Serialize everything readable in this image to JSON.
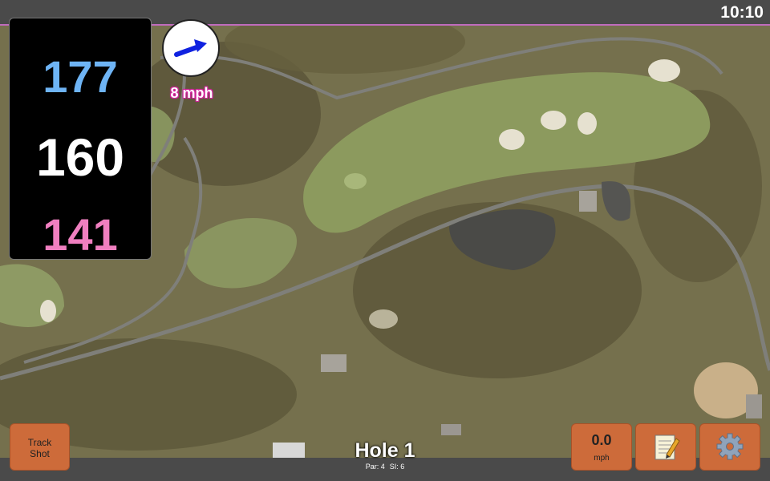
{
  "status_bar": {
    "time": "10:10"
  },
  "distances": {
    "back": "177",
    "middle": "160",
    "front": "141"
  },
  "wind": {
    "speed": "8 mph",
    "arrow_icon": "wind-arrow-icon",
    "arrow_color": "#1022e0"
  },
  "buttons": {
    "track_shot_line1": "Track",
    "track_shot_line2": "Shot",
    "speed_value": "0.0",
    "speed_unit": "mph",
    "notes_icon": "notepad-icon",
    "settings_icon": "gear-icon"
  },
  "hole": {
    "title": "Hole 1",
    "par": "Par: 4",
    "si": "SI: 6"
  },
  "colors": {
    "back": "#6eb4f5",
    "middle": "#ffffff",
    "front": "#f07fc0",
    "button": "#cd6b3a",
    "accent_border": "#c06bbd"
  }
}
